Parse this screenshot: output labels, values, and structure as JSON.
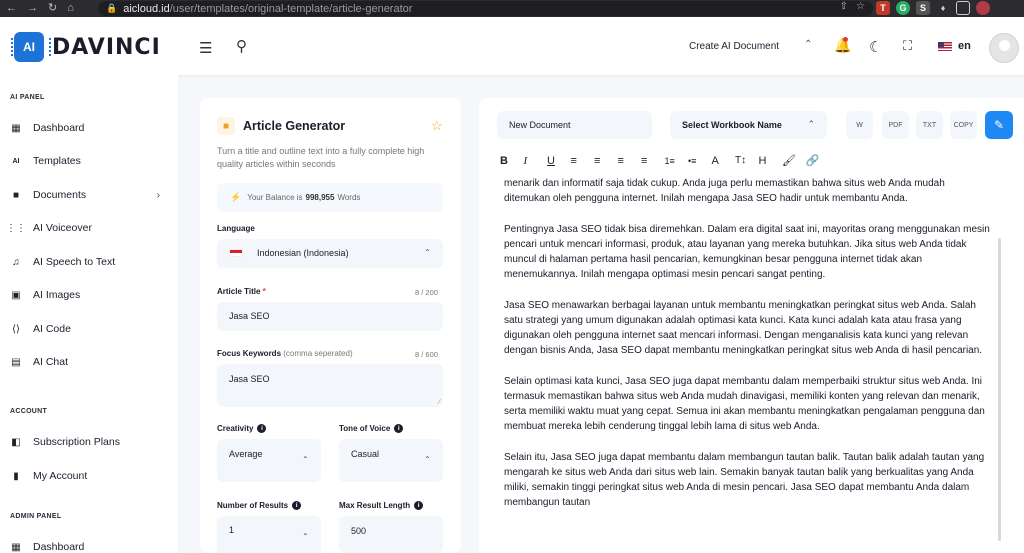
{
  "browser": {
    "url_host": "aicloud.id",
    "url_path": "/user/templates/original-template/article-generator"
  },
  "header": {
    "logo_mark": "AI",
    "logo_text": "DAVINCI",
    "create_label": "Create AI Document",
    "language": "en"
  },
  "sidebar": {
    "sections": [
      {
        "title": "AI PANEL",
        "items": [
          {
            "label": "Dashboard",
            "icon": "dashboard-icon"
          },
          {
            "label": "Templates",
            "icon": "ai-chip-icon"
          },
          {
            "label": "Documents",
            "icon": "folder-icon",
            "has_submenu": true
          },
          {
            "label": "AI Voiceover",
            "icon": "waveform-icon"
          },
          {
            "label": "AI Speech to Text",
            "icon": "music-file-icon"
          },
          {
            "label": "AI Images",
            "icon": "image-scan-icon"
          },
          {
            "label": "AI Code",
            "icon": "code-icon"
          },
          {
            "label": "AI Chat",
            "icon": "chat-icon"
          }
        ]
      },
      {
        "title": "ACCOUNT",
        "items": [
          {
            "label": "Subscription Plans",
            "icon": "subscription-icon"
          },
          {
            "label": "My Account",
            "icon": "account-icon"
          }
        ]
      },
      {
        "title": "ADMIN PANEL",
        "items": [
          {
            "label": "Dashboard",
            "icon": "dashboard-icon"
          }
        ]
      }
    ]
  },
  "generator": {
    "title": "Article Generator",
    "description": "Turn a title and outline text into a fully complete high quality articles within seconds",
    "balance_prefix": "Your Balance is",
    "balance_value": "998,955",
    "balance_suffix": "Words",
    "language_label": "Language",
    "language_value": "Indonesian (Indonesia)",
    "title_label": "Article Title",
    "title_counter": "8 / 200",
    "title_value": "Jasa SEO",
    "keywords_label": "Focus Keywords",
    "keywords_hint": "(comma seperated)",
    "keywords_counter": "8 / 600",
    "keywords_value": "Jasa SEO",
    "creativity_label": "Creativity",
    "creativity_value": "Average",
    "tone_label": "Tone of Voice",
    "tone_value": "Casual",
    "results_label": "Number of Results",
    "results_value": "1",
    "maxlen_label": "Max Result Length",
    "maxlen_value": "500"
  },
  "document": {
    "name": "New Document",
    "workbook_placeholder": "Select Workbook Name",
    "download_buttons": [
      "W",
      "PDF",
      "TXT",
      "COPY"
    ],
    "toolbar": [
      "B",
      "I",
      "U",
      "align-left",
      "align-center",
      "align-right",
      "align-justify",
      "ordered-list",
      "bullet-list",
      "A",
      "text-size",
      "H",
      "brush",
      "link"
    ],
    "paragraphs": [
      "menarik dan informatif saja tidak cukup. Anda juga perlu memastikan bahwa situs web Anda mudah ditemukan oleh pengguna internet. Inilah mengapa Jasa SEO hadir untuk membantu Anda.",
      "Pentingnya Jasa SEO tidak bisa diremehkan. Dalam era digital saat ini, mayoritas orang menggunakan mesin pencari untuk mencari informasi, produk, atau layanan yang mereka butuhkan. Jika situs web Anda tidak muncul di halaman pertama hasil pencarian, kemungkinan besar pengguna internet tidak akan menemukannya. Inilah mengapa optimasi mesin pencari sangat penting.",
      "Jasa SEO menawarkan berbagai layanan untuk membantu meningkatkan peringkat situs web Anda. Salah satu strategi yang umum digunakan adalah optimasi kata kunci. Kata kunci adalah kata atau frasa yang digunakan oleh pengguna internet saat mencari informasi. Dengan menganalisis kata kunci yang relevan dengan bisnis Anda, Jasa SEO dapat membantu meningkatkan peringkat situs web Anda di hasil pencarian.",
      "Selain optimasi kata kunci, Jasa SEO juga dapat membantu dalam memperbaiki struktur situs web Anda. Ini termasuk memastikan bahwa situs web Anda mudah dinavigasi, memiliki konten yang relevan dan menarik, serta memiliki waktu muat yang cepat. Semua ini akan membantu meningkatkan pengalaman pengguna dan membuat mereka lebih cenderung tinggal lebih lama di situs web Anda.",
      "Selain itu, Jasa SEO juga dapat membantu dalam membangun tautan balik. Tautan balik adalah tautan yang mengarah ke situs web Anda dari situs web lain. Semakin banyak tautan balik yang berkualitas yang Anda miliki, semakin tinggi peringkat situs web Anda di mesin pencari. Jasa SEO dapat membantu Anda dalam membangun tautan"
    ]
  },
  "colors": {
    "accent": "#1e88f5",
    "brand": "#1e73d9",
    "star": "#f0a020",
    "required": "#e53935"
  }
}
